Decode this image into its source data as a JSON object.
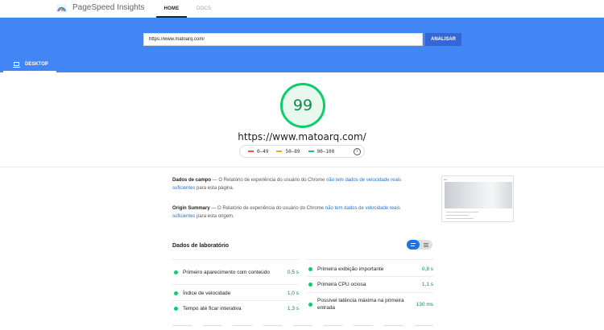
{
  "app": {
    "brand": "PageSpeed Insights"
  },
  "nav": {
    "home": "HOME",
    "docs": "DOCS"
  },
  "search": {
    "url_value": "https://www.matoarq.com/",
    "analyze_label": "ANALISAR"
  },
  "device_tab": {
    "label": "DESKTOP"
  },
  "report": {
    "score": "99",
    "url": "https://www.matoarq.com/",
    "legend": [
      {
        "range": "0–49",
        "color": "#ff4e42"
      },
      {
        "range": "50–89",
        "color": "#ffa400"
      },
      {
        "range": "90–100",
        "color": "#0cce6b"
      }
    ]
  },
  "field_data": {
    "title": "Dados de campo",
    "text": " — O Relatório de experiência do usuário do Chrome ",
    "link": "não tem dados de velocidade reais suficientes",
    "suffix": " para esta página."
  },
  "origin_summary": {
    "title": "Origin Summary",
    "text": " — O Relatório de experiência do usuário do Chrome ",
    "link": "não tem dados de velocidade reais suficientes",
    "suffix": " para esta origem."
  },
  "lab": {
    "title": "Dados de laboratório",
    "metrics_left": [
      {
        "name": "Primeiro aparecimento com conteúdo",
        "value": "0,5 s"
      },
      {
        "name": "Índice de velocidade",
        "value": "1,0 s"
      },
      {
        "name": "Tempo até ficar interativa",
        "value": "1,3 s"
      }
    ],
    "metrics_right": [
      {
        "name": "Primeira exibição importante",
        "value": "0,8 s"
      },
      {
        "name": "Primeira CPU ociosa",
        "value": "1,1 s"
      },
      {
        "name": "Possível latência máxima na primeira entrada",
        "value": "130 ms"
      }
    ]
  }
}
